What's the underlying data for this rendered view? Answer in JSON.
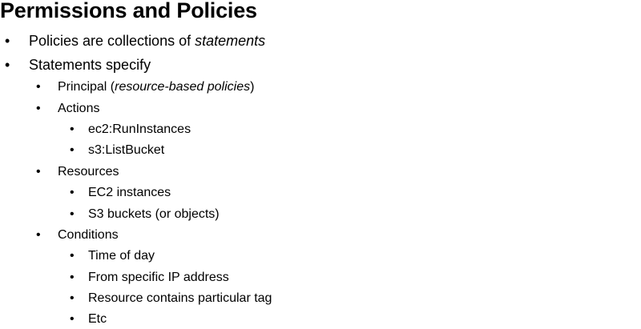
{
  "slide": {
    "title": "Permissions and Policies",
    "bullet_glyph": "•",
    "points": {
      "policies": {
        "prefix": "Policies are collections of ",
        "emphasis": "statements"
      },
      "statements": {
        "label": "Statements specify",
        "principal": {
          "prefix": "Principal (",
          "emphasis": "resource-based policies",
          "suffix": ")"
        },
        "actions": {
          "label": "Actions",
          "items": [
            "ec2:RunInstances",
            "s3:ListBucket"
          ]
        },
        "resources": {
          "label": "Resources",
          "items": [
            "EC2 instances",
            "S3 buckets (or objects)"
          ]
        },
        "conditions": {
          "label": "Conditions",
          "items": [
            "Time of day",
            "From specific IP address",
            "Resource contains particular tag",
            "Etc"
          ]
        }
      }
    }
  }
}
